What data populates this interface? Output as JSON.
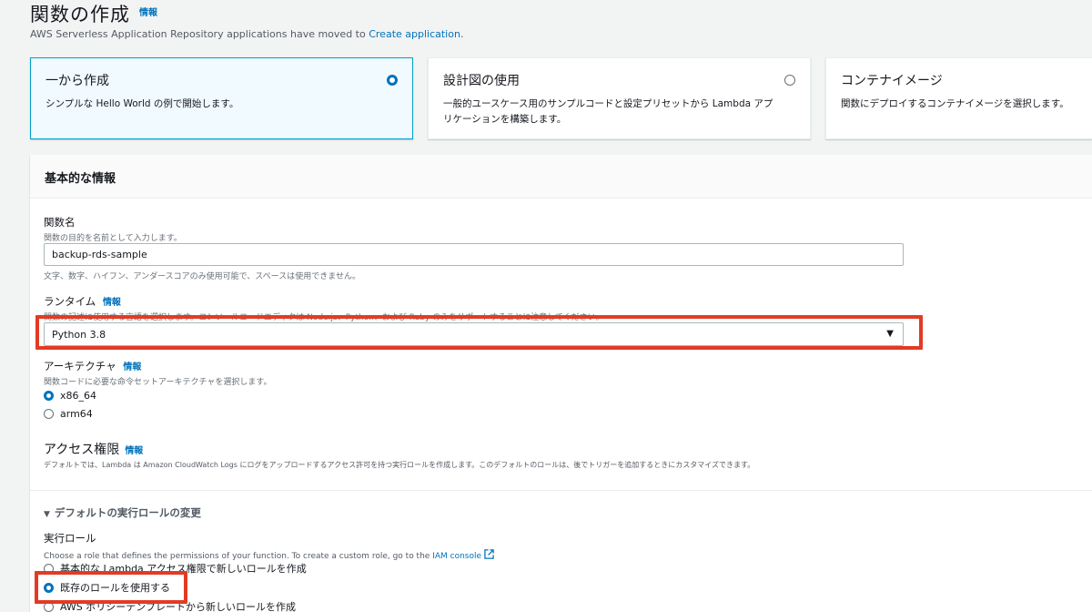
{
  "header": {
    "title": "関数の作成",
    "info_label": "情報",
    "moved_text": "AWS Serverless Application Repository applications have moved to ",
    "moved_link": "Create application",
    "moved_suffix": "."
  },
  "tiles": [
    {
      "title": "一から作成",
      "description": "シンプルな Hello World の例で開始します。",
      "selected": true
    },
    {
      "title": "設計図の使用",
      "description": "一般的ユースケース用のサンプルコードと設定プリセットから Lambda アプリケーションを構築します。",
      "selected": false
    },
    {
      "title": "コンテナイメージ",
      "description": "関数にデプロイするコンテナイメージを選択します。",
      "selected": false
    }
  ],
  "basic_info": {
    "title": "基本的な情報",
    "function_name": {
      "label": "関数名",
      "description": "関数の目的を名前として入力します。",
      "value": "backup-rds-sample",
      "constraint": "文字、数字、ハイフン、アンダースコアのみ使用可能で、スペースは使用できません。"
    },
    "runtime": {
      "label": "ランタイム",
      "info_label": "情報",
      "description": "関数の記述に使用する言語を選択します。コンソールコードエディタは Node.js、Python、および Ruby のみをサポートすることに注意してください。",
      "value": "Python 3.8"
    },
    "architecture": {
      "label": "アーキテクチャ",
      "info_label": "情報",
      "description": "関数コードに必要な命令セットアーキテクチャを選択します。",
      "options": [
        "x86_64",
        "arm64"
      ],
      "selected": "x86_64"
    },
    "permissions": {
      "title": "アクセス権限",
      "info_label": "情報",
      "description": "デフォルトでは、Lambda は Amazon CloudWatch Logs にログをアップロードするアクセス許可を持つ実行ロールを作成します。このデフォルトのロールは、後でトリガーを追加するときにカスタマイズできます。"
    },
    "role_expander": "デフォルトの実行ロールの変更",
    "execution_role": {
      "label": "実行ロール",
      "description": "Choose a role that defines the permissions of your function. To create a custom role, go to the ",
      "link": "IAM console",
      "options": [
        "基本的な Lambda アクセス権限で新しいロールを作成",
        "既存のロールを使用する",
        "AWS ポリシーテンプレートから新しいロールを作成"
      ],
      "selected": "既存のロールを使用する"
    }
  },
  "colors": {
    "accent": "#0073bb",
    "highlight": "#e23b25",
    "tile_selected_bg": "#f1faff"
  }
}
